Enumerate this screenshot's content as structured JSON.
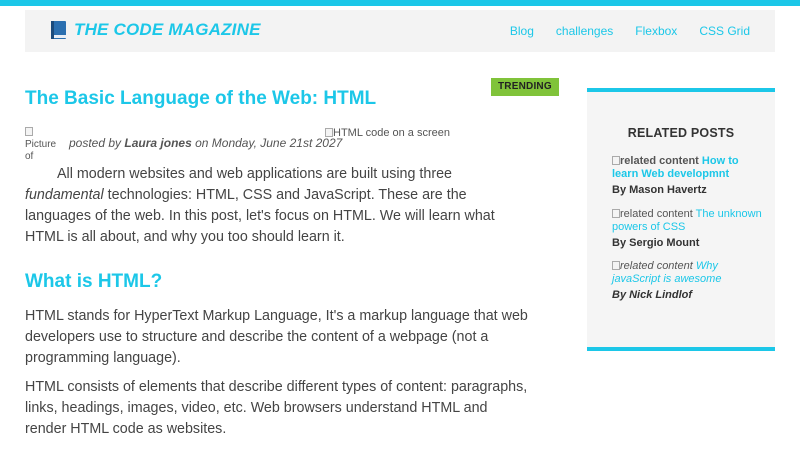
{
  "header": {
    "logo": {
      "icon": "book-icon",
      "text": "THE CODE MAGAZINE"
    },
    "nav": [
      "Blog",
      "challenges",
      "Flexbox",
      "CSS Grid"
    ]
  },
  "post": {
    "badge": "TRENDING",
    "title": "The Basic Language of the Web: HTML",
    "author_image_alt": "Picture of",
    "posted_prefix": "posted by",
    "author": "Laura jones",
    "date": "on Monday, June 21st 2027",
    "hero_image_alt": "HTML code on a screen",
    "intro": {
      "before": "All modern websites and web applications are built using three ",
      "em": "fundamental",
      "after": " technologies: HTML, CSS and JavaScript. These are the languages of the web. In this post, let's focus on HTML. We will learn what HTML is all about, and why you too should learn it."
    },
    "section_title": "What is HTML?",
    "paragraphs": [
      "HTML stands for HyperText Markup Language, It's a markup language that web developers use to structure and describe the content of a webpage (not a programming language).",
      "HTML consists of elements that describe different types of content: paragraphs, links, headings, images, video, etc. Web browsers understand HTML and render HTML code as websites."
    ]
  },
  "sidebar": {
    "title": "RELATED POSTS",
    "items": [
      {
        "image_alt": "related content",
        "link": "How to learn Web developmnt",
        "byline": "By Mason Havertz"
      },
      {
        "image_alt": "related content",
        "link": "The unknown powers of CSS",
        "byline": "By Sergio Mount"
      },
      {
        "image_alt": "related content",
        "link": "Why javaScript is awesome",
        "byline": "By Nick Lindlof"
      }
    ]
  },
  "colors": {
    "accent": "#1cc7e8",
    "badge": "#80c33a",
    "text": "#444444",
    "header_bg": "#f3f3f3",
    "sidebar_bg": "#f5f5f5"
  }
}
